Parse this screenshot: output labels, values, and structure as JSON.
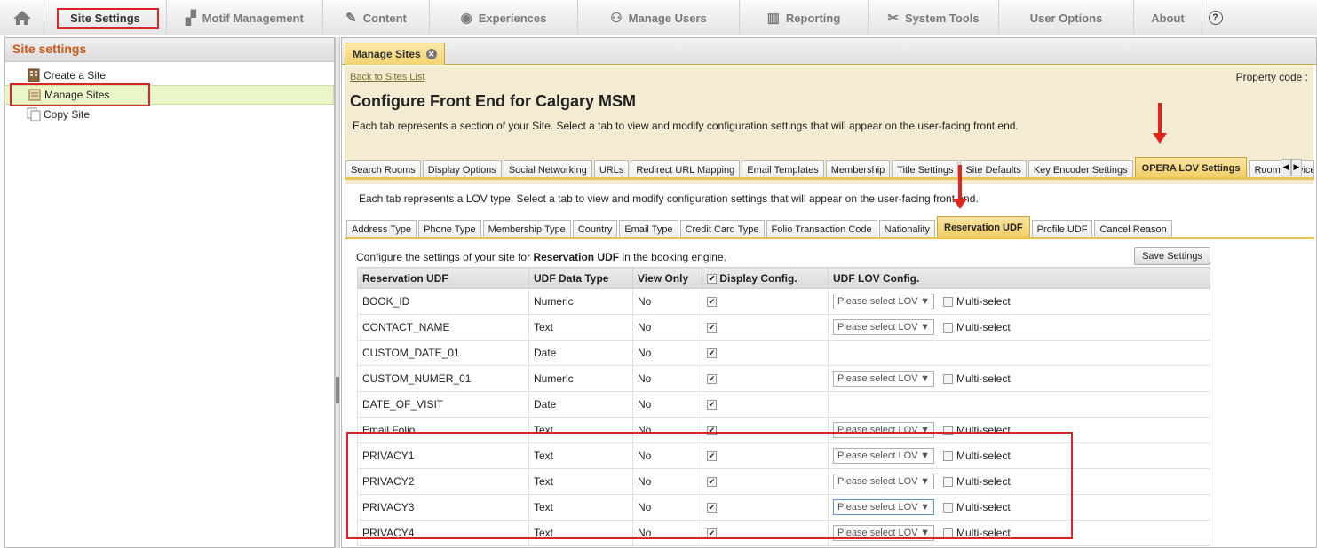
{
  "topnav": {
    "home_icon": "home-icon",
    "items": [
      {
        "label": "Site Settings",
        "icon": ""
      },
      {
        "label": "Motif Management",
        "icon": "▞"
      },
      {
        "label": "Content",
        "icon": "✎"
      },
      {
        "label": "Experiences",
        "icon": "◉"
      },
      {
        "label": "Manage Users",
        "icon": "⚇"
      },
      {
        "label": "Reporting",
        "icon": "▥"
      },
      {
        "label": "System Tools",
        "icon": "✂"
      },
      {
        "label": "User Options",
        "icon": ""
      },
      {
        "label": "About",
        "icon": ""
      }
    ],
    "help_icon": "?"
  },
  "sidebar": {
    "title": "Site settings",
    "items": [
      {
        "label": "Create a Site"
      },
      {
        "label": "Manage Sites"
      },
      {
        "label": "Copy Site"
      }
    ]
  },
  "main": {
    "tab_label": "Manage Sites",
    "back_link": "Back to Sites List",
    "property_code": "Property code :",
    "title": "Configure Front End for Calgary MSM",
    "description": "Each tab represents a section of your Site. Select a tab to view and modify configuration settings that will appear on the user-facing front end.",
    "section_tabs": [
      "Search Rooms",
      "Display Options",
      "Social Networking",
      "URLs",
      "Redirect URL Mapping",
      "Email Templates",
      "Membership",
      "Title Settings",
      "Site Defaults",
      "Key Encoder Settings",
      "OPERA LOV Settings",
      "Room Service S"
    ],
    "lov_description": "Each tab represents a LOV type. Select a tab to view and modify configuration settings that will appear on the user-facing front end.",
    "lov_tabs": [
      "Address Type",
      "Phone Type",
      "Membership Type",
      "Country",
      "Email Type",
      "Credit Card Type",
      "Folio Transaction Code",
      "Nationality",
      "Reservation UDF",
      "Profile UDF",
      "Cancel Reason"
    ],
    "configure_prefix": "Configure the settings of your site for ",
    "configure_bold": "Reservation UDF",
    "configure_suffix": " in the booking engine.",
    "save_button": "Save Settings",
    "table": {
      "headers": [
        "Reservation UDF",
        "UDF Data Type",
        "View Only",
        "Display Config.",
        "UDF LOV Config."
      ],
      "select_placeholder": "Please select LOV",
      "multi_label": "Multi-select",
      "rows": [
        {
          "name": "BOOK_ID",
          "type": "Numeric",
          "view_only": "No",
          "display": true,
          "lov": true
        },
        {
          "name": "CONTACT_NAME",
          "type": "Text",
          "view_only": "No",
          "display": true,
          "lov": true
        },
        {
          "name": "CUSTOM_DATE_01",
          "type": "Date",
          "view_only": "No",
          "display": true,
          "lov": false
        },
        {
          "name": "CUSTOM_NUMER_01",
          "type": "Numeric",
          "view_only": "No",
          "display": true,
          "lov": true
        },
        {
          "name": "DATE_OF_VISIT",
          "type": "Date",
          "view_only": "No",
          "display": true,
          "lov": false
        },
        {
          "name": "Email Folio",
          "type": "Text",
          "view_only": "No",
          "display": true,
          "lov": true
        },
        {
          "name": "PRIVACY1",
          "type": "Text",
          "view_only": "No",
          "display": true,
          "lov": true
        },
        {
          "name": "PRIVACY2",
          "type": "Text",
          "view_only": "No",
          "display": true,
          "lov": true
        },
        {
          "name": "PRIVACY3",
          "type": "Text",
          "view_only": "No",
          "display": true,
          "lov": true
        },
        {
          "name": "PRIVACY4",
          "type": "Text",
          "view_only": "No",
          "display": true,
          "lov": true
        }
      ]
    }
  },
  "colors": {
    "accent_orange": "#cc5a16",
    "active_tab": "#f0cd63",
    "highlight_red": "#d92525",
    "selected_tree": "#eaf5c8"
  }
}
